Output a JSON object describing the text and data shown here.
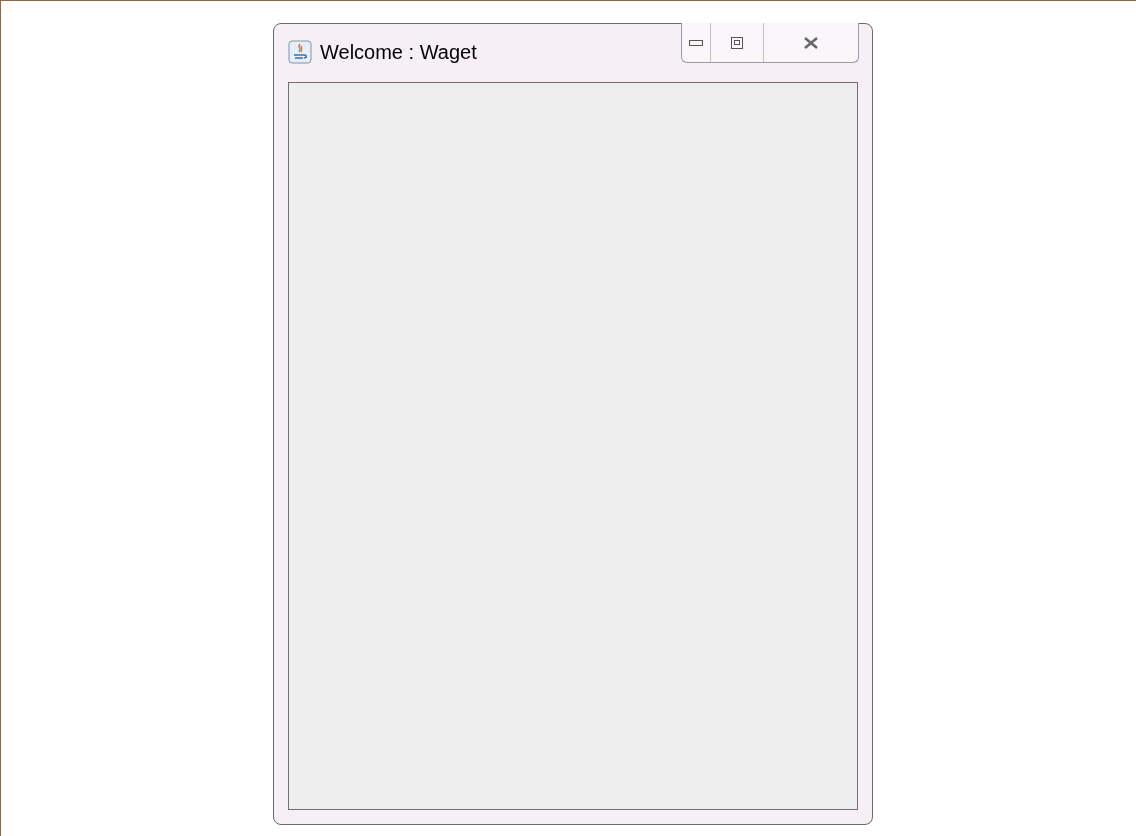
{
  "window": {
    "title": "Welcome : Waget"
  }
}
